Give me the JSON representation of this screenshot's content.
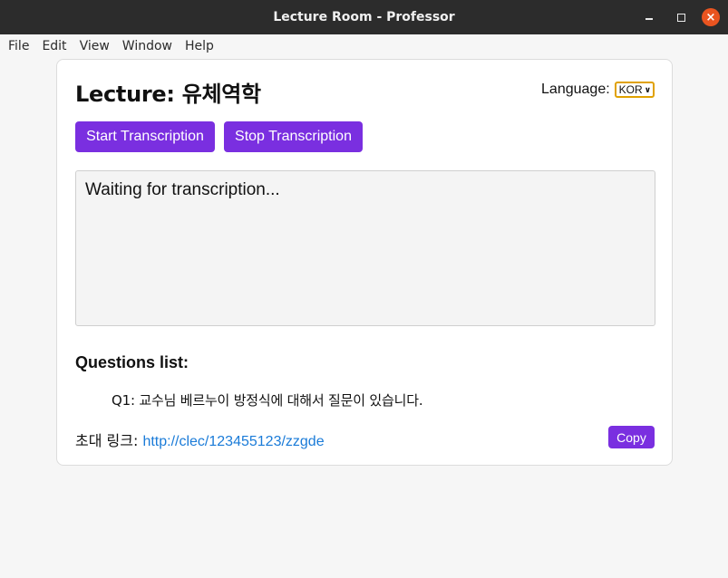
{
  "window": {
    "title": "Lecture Room - Professor"
  },
  "menu": [
    "File",
    "Edit",
    "View",
    "Window",
    "Help"
  ],
  "lecture": {
    "title": "Lecture: 유체역학"
  },
  "language": {
    "label": "Language:",
    "selected": "KOR"
  },
  "buttons": {
    "start": "Start Transcription",
    "stop": "Stop Transcription",
    "copy": "Copy"
  },
  "transcript": {
    "text": "Waiting for transcription..."
  },
  "questions": {
    "heading": "Questions list:",
    "items": [
      "Q1: 교수님 베르누이 방정식에 대해서 질문이 있습니다."
    ]
  },
  "invite": {
    "label": "초대 링크:",
    "url": "http://clec/123455123/zzgde"
  },
  "colors": {
    "accent": "#7a2fe0",
    "link": "#1a7bd8",
    "close_button": "#e95420"
  }
}
